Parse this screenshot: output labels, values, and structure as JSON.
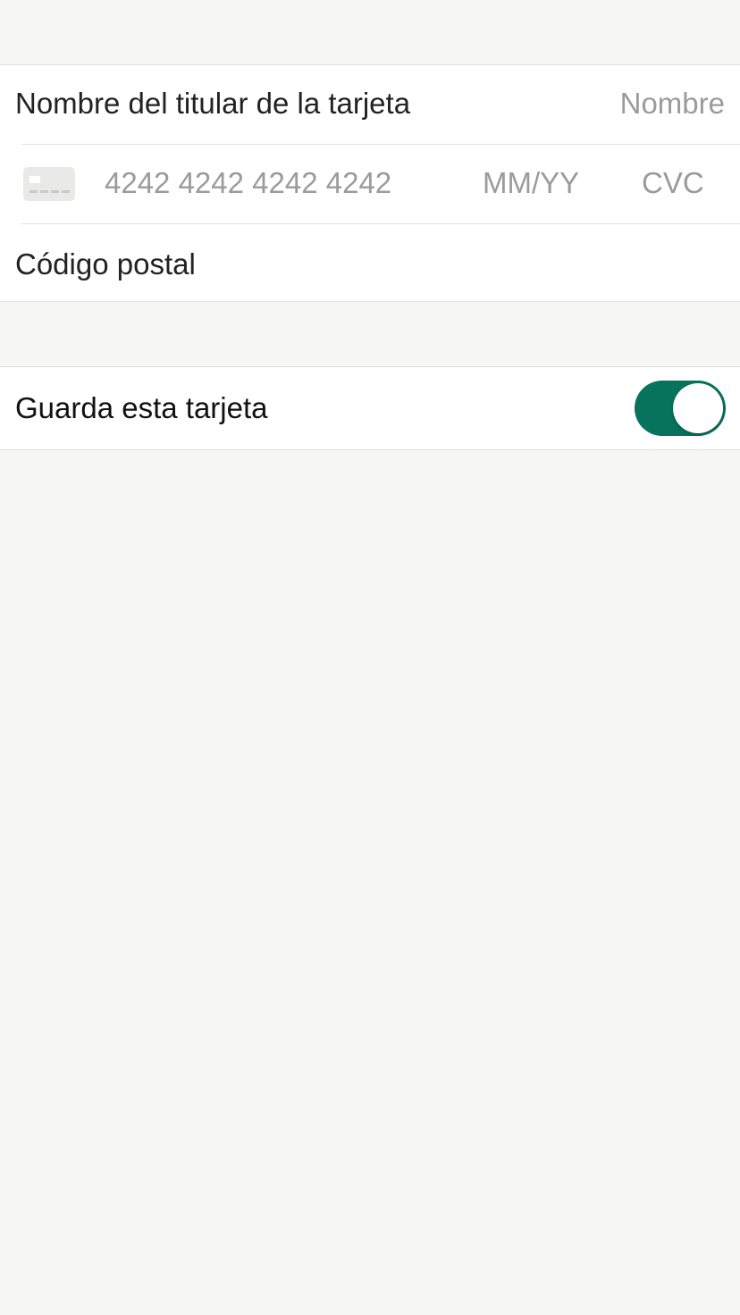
{
  "card_form": {
    "cardholder": {
      "label": "Nombre del titular de la tarjeta",
      "placeholder": "Nombre"
    },
    "card_number": {
      "icon": "credit-card-icon",
      "placeholder": "4242 4242 4242 4242"
    },
    "expiry": {
      "placeholder": "MM/YY"
    },
    "cvc": {
      "placeholder": "CVC"
    },
    "postal_code": {
      "label": "Código postal",
      "value": ""
    }
  },
  "save_card": {
    "label": "Guarda esta tarjeta",
    "enabled": true
  },
  "colors": {
    "background": "#f6f6f4",
    "toggle_on": "#08735d",
    "placeholder": "#9b9b9b",
    "text": "#222222",
    "separator": "#e1e1df"
  }
}
